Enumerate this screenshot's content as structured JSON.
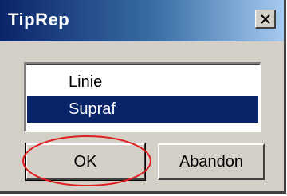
{
  "window": {
    "title": "TipRep",
    "close_glyph": "×"
  },
  "listbox": {
    "items": [
      {
        "label": "Linie",
        "selected": false
      },
      {
        "label": "Supraf",
        "selected": true
      }
    ]
  },
  "buttons": {
    "ok_label": "OK",
    "cancel_label": "Abandon"
  },
  "colors": {
    "title_start": "#0a246a",
    "title_end": "#a6caf0",
    "selection": "#0a246a",
    "face": "#d4d0c8",
    "annotation_ellipse": "#e02020"
  }
}
